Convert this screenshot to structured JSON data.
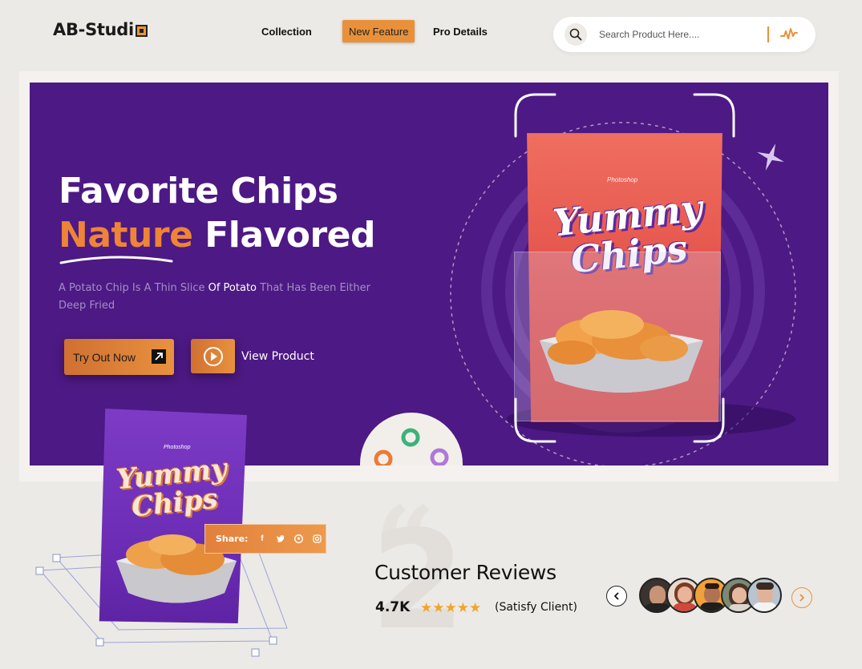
{
  "header": {
    "logo_text": "AB-Studi",
    "nav": {
      "collection": "Collection",
      "new_feature": "New Feature",
      "pro_details": "Pro Details"
    },
    "search": {
      "placeholder": "Search Product Here...."
    }
  },
  "hero": {
    "title_line1": "Favorite Chips",
    "title_line2_accent": "Nature",
    "title_line2_rest": " Flavored",
    "desc_part1": "A Potato Chip Is A Thin Slice ",
    "desc_highlight1": "Of Potato",
    "desc_part2": " That Has Been Either Deep Fried",
    "try_button": "Try Out Now",
    "view_product": "View Product",
    "bag_brand": "Photoshop",
    "bag_label_line1": "Yummy",
    "bag_label_line2": "Chips"
  },
  "featured_bag": {
    "brand": "Photoshop",
    "label_line1": "Yummy",
    "label_line2": "Chips"
  },
  "share": {
    "label": "Share:",
    "icons": [
      "facebook-icon",
      "twitter-icon",
      "pinterest-icon",
      "instagram-icon"
    ]
  },
  "reviews": {
    "decor_number": "2",
    "title": "Customer Reviews",
    "count": "4.7K",
    "rating_stars": 5,
    "caption": "(Satisfy Client)"
  },
  "colors": {
    "accent": "#e9913a",
    "hero_bg": "#4d1984",
    "page_bg": "#eceae6"
  }
}
